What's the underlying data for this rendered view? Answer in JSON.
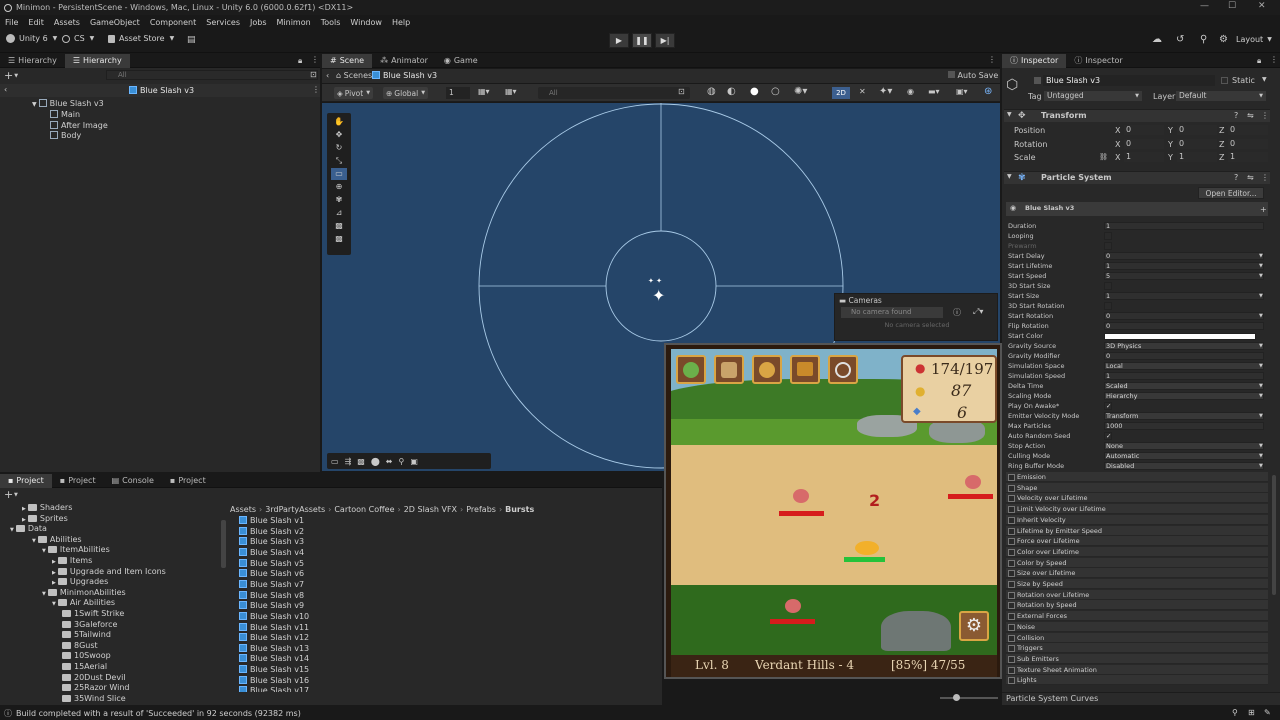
{
  "window": {
    "title": "Minimon - PersistentScene - Windows, Mac, Linux - Unity 6.0 (6000.0.62f1) <DX11>"
  },
  "menu": [
    "File",
    "Edit",
    "Assets",
    "GameObject",
    "Component",
    "Services",
    "Jobs",
    "Minimon",
    "Tools",
    "Window",
    "Help"
  ],
  "toolbar": {
    "account": "Unity 6",
    "cs": "CS",
    "asset_store": "Asset Store",
    "layout": "Layout"
  },
  "hierarchy": {
    "tabs": [
      "Hierarchy",
      "Hierarchy"
    ],
    "search_placeholder": "All",
    "breadcrumb": "Blue Slash v3",
    "root": "Blue Slash v3",
    "children": [
      "Main",
      "After Image",
      "Body"
    ]
  },
  "scene": {
    "tabs": [
      "Scene",
      "Animator",
      "Game"
    ],
    "breadcrumb_root": "Scenes",
    "breadcrumb_item": "Blue Slash v3",
    "auto_save": "Auto Save",
    "pivot": "Pivot",
    "global": "Global",
    "grid_value": "1",
    "search_placeholder": "All",
    "mode_2d": "2D",
    "cameras": {
      "title": "Cameras",
      "dropdown": "No camera found",
      "message": "No camera selected"
    }
  },
  "game": {
    "food": "174/197",
    "coins": "87",
    "fish": "6",
    "level": "Lvl. 8",
    "area": "Verdant Hills - 4",
    "progress": "[85%] 47/55",
    "enemy_damage": "2"
  },
  "project": {
    "tabs": [
      "Project",
      "Project",
      "Console",
      "Project"
    ],
    "folders": [
      {
        "label": "Shaders",
        "indent": 0
      },
      {
        "label": "Sprites",
        "indent": 0
      },
      {
        "label": "Data",
        "indent": -1
      },
      {
        "label": "Abilities",
        "indent": 1
      },
      {
        "label": "ItemAbilities",
        "indent": 2
      },
      {
        "label": "Items",
        "indent": 3
      },
      {
        "label": "Upgrade and Item Icons",
        "indent": 3
      },
      {
        "label": "Upgrades",
        "indent": 3
      },
      {
        "label": "MinimonAbilities",
        "indent": 2
      },
      {
        "label": "Air Abilities",
        "indent": 3
      },
      {
        "label": "1Swift Strike",
        "indent": 4
      },
      {
        "label": "3Galeforce",
        "indent": 4
      },
      {
        "label": "5Tailwind",
        "indent": 4
      },
      {
        "label": "8Gust",
        "indent": 4
      },
      {
        "label": "10Swoop",
        "indent": 4
      },
      {
        "label": "15Aerial",
        "indent": 4
      },
      {
        "label": "20Dust Devil",
        "indent": 4
      },
      {
        "label": "25Razor Wind",
        "indent": 4
      },
      {
        "label": "35Wind Slice",
        "indent": 4
      }
    ],
    "path": [
      "Assets",
      "3rdPartyAssets",
      "Cartoon Coffee",
      "2D Slash VFX",
      "Prefabs",
      "Bursts"
    ],
    "assets": [
      "Blue Slash v1",
      "Blue Slash v2",
      "Blue Slash v3",
      "Blue Slash v4",
      "Blue Slash v5",
      "Blue Slash v6",
      "Blue Slash v7",
      "Blue Slash v8",
      "Blue Slash v9",
      "Blue Slash v10",
      "Blue Slash v11",
      "Blue Slash v12",
      "Blue Slash v13",
      "Blue Slash v14",
      "Blue Slash v15",
      "Blue Slash v16",
      "Blue Slash v17"
    ]
  },
  "status": {
    "message": "Build completed with a result of 'Succeeded' in 92 seconds (92382 ms)"
  },
  "inspector": {
    "tabs": [
      "Inspector",
      "Inspector"
    ],
    "object_name": "Blue Slash v3",
    "static": "Static",
    "tag_label": "Tag",
    "tag_value": "Untagged",
    "layer_label": "Layer",
    "layer_value": "Default",
    "transform": {
      "title": "Transform",
      "rows": [
        {
          "label": "Position",
          "x": "0",
          "y": "0",
          "z": "0"
        },
        {
          "label": "Rotation",
          "x": "0",
          "y": "0",
          "z": "0"
        },
        {
          "label": "Scale",
          "x": "1",
          "y": "1",
          "z": "1"
        }
      ]
    },
    "particle": {
      "title": "Particle System",
      "open_editor": "Open Editor...",
      "subheader": "Blue Slash v3",
      "props": [
        {
          "label": "Duration",
          "value": "1"
        },
        {
          "label": "Looping",
          "value": ""
        },
        {
          "label": "Prewarm",
          "value": ""
        },
        {
          "label": "Start Delay",
          "value": "0"
        },
        {
          "label": "Start Lifetime",
          "value": "1"
        },
        {
          "label": "Start Speed",
          "value": "5"
        },
        {
          "label": "3D Start Size",
          "value": ""
        },
        {
          "label": "Start Size",
          "value": "1"
        },
        {
          "label": "3D Start Rotation",
          "value": ""
        },
        {
          "label": "Start Rotation",
          "value": "0"
        },
        {
          "label": "Flip Rotation",
          "value": "0"
        },
        {
          "label": "Start Color",
          "value": ""
        },
        {
          "label": "Gravity Source",
          "value": "3D Physics"
        },
        {
          "label": "Gravity Modifier",
          "value": "0"
        },
        {
          "label": "Simulation Space",
          "value": "Local"
        },
        {
          "label": "Simulation Speed",
          "value": "1"
        },
        {
          "label": "Delta Time",
          "value": "Scaled"
        },
        {
          "label": "Scaling Mode",
          "value": "Hierarchy"
        },
        {
          "label": "Play On Awake*",
          "value": "✓"
        },
        {
          "label": "Emitter Velocity Mode",
          "value": "Transform"
        },
        {
          "label": "Max Particles",
          "value": "1000"
        },
        {
          "label": "Auto Random Seed",
          "value": "✓"
        },
        {
          "label": "Stop Action",
          "value": "None"
        },
        {
          "label": "Culling Mode",
          "value": "Automatic"
        },
        {
          "label": "Ring Buffer Mode",
          "value": "Disabled"
        }
      ],
      "modules": [
        "Emission",
        "Shape",
        "Velocity over Lifetime",
        "Limit Velocity over Lifetime",
        "Inherit Velocity",
        "Lifetime by Emitter Speed",
        "Force over Lifetime",
        "Color over Lifetime",
        "Color by Speed",
        "Size over Lifetime",
        "Size by Speed",
        "Rotation over Lifetime",
        "Rotation by Speed",
        "External Forces",
        "Noise",
        "Collision",
        "Triggers",
        "Sub Emitters",
        "Texture Sheet Animation",
        "Lights"
      ],
      "curves": "Particle System Curves"
    }
  }
}
